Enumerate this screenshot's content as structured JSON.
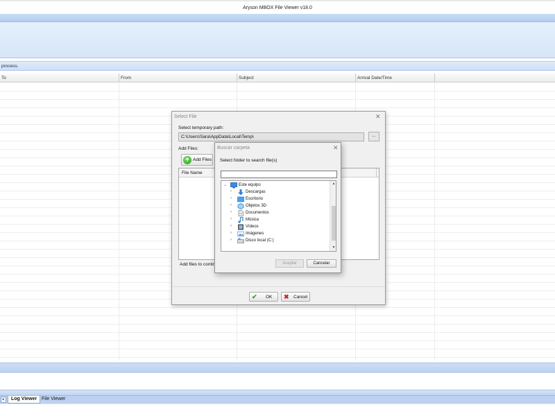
{
  "window": {
    "title": "Aryson MBOX File Viewer v18.0"
  },
  "status_top": {
    "text": "process."
  },
  "grid": {
    "columns": [
      "To",
      "From",
      "Subject",
      "Arrival Date/Time"
    ]
  },
  "tabs": {
    "nav_glyph": "▸",
    "items": [
      {
        "label": "Log Viewer",
        "active": true
      },
      {
        "label": "File Viewer",
        "active": false
      }
    ]
  },
  "select_file_dialog": {
    "title": "Select File",
    "close_glyph": "✕",
    "temp_path_label": "Select temporary path:",
    "temp_path_value": "C:\\Users\\Sara\\AppData\\Local\\Temp\\",
    "browse_label": "...",
    "add_files_label": "Add Files:",
    "add_files_button": "Add Files",
    "add_files_icon": "plus-circle-icon",
    "file_list_header": "File Name",
    "add_files_note": "Add files to continu",
    "ok_label": "OK",
    "ok_icon": "checkmark-icon",
    "cancel_label": "Cancel",
    "cancel_icon": "red-x-icon"
  },
  "folder_dialog": {
    "title": "Buscar carpeta",
    "close_glyph": "✕",
    "prompt": "Select folder to search file(s)",
    "input_value": "",
    "tree": [
      {
        "label": "Este equipo",
        "icon": "computer-icon",
        "expanded": true,
        "level": 0
      },
      {
        "label": "Descargas",
        "icon": "downloads-icon",
        "level": 1
      },
      {
        "label": "Escritorio",
        "icon": "desktop-icon",
        "level": 1
      },
      {
        "label": "Objetos 3D",
        "icon": "3d-objects-icon",
        "level": 1
      },
      {
        "label": "Documentos",
        "icon": "documents-icon",
        "level": 1
      },
      {
        "label": "Música",
        "icon": "music-icon",
        "level": 1
      },
      {
        "label": "Vídeos",
        "icon": "videos-icon",
        "level": 1
      },
      {
        "label": "Imágenes",
        "icon": "pictures-icon",
        "level": 1
      },
      {
        "label": "Disco local (C:)",
        "icon": "drive-icon",
        "level": 1
      }
    ],
    "accept_label": "Aceptar",
    "cancel_label": "Cancelar"
  },
  "colors": {
    "ribbon": "#d6e5f8",
    "accent_border": "#9fbbe3",
    "ok_green": "#3aa12b",
    "cancel_red": "#d62020"
  }
}
